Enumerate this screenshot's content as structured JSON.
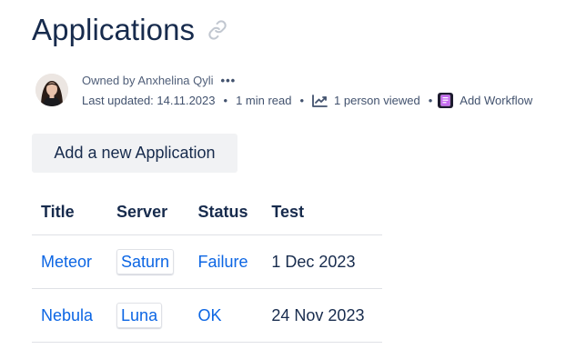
{
  "page": {
    "title": "Applications",
    "link_icon": "link-icon"
  },
  "byline": {
    "owned_by": "Owned by Anxhelina Qyli",
    "more_icon": "more-icon",
    "more_label": "•••",
    "last_updated": "Last updated: 14.11.2023",
    "read_time": "1 min read",
    "views": "1 person viewed",
    "add_workflow": "Add Workflow",
    "separator": "•"
  },
  "actions": {
    "add_application": "Add a new Application"
  },
  "table": {
    "headers": [
      "Title",
      "Server",
      "Status",
      "Test"
    ],
    "rows": [
      {
        "title": "Meteor",
        "server": "Saturn",
        "status": "Failure",
        "test": "1 Dec 2023"
      },
      {
        "title": "Nebula",
        "server": "Luna",
        "status": "OK",
        "test": "24 Nov 2023"
      }
    ]
  },
  "colors": {
    "link": "#0c66e4",
    "text": "#172b4d",
    "muted": "#505f79",
    "button_bg": "#f1f2f4",
    "divider": "#dfe1e6"
  }
}
